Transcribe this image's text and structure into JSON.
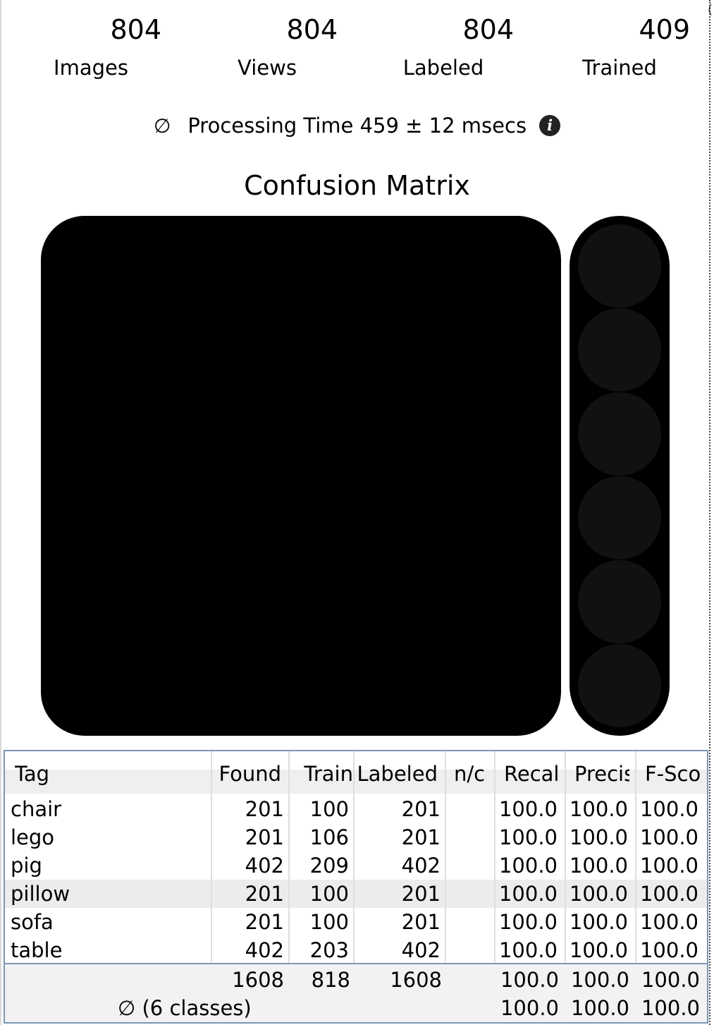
{
  "stats": [
    {
      "value": "804",
      "label": "Images"
    },
    {
      "value": "804",
      "label": "Views"
    },
    {
      "value": "804",
      "label": "Labeled"
    },
    {
      "value": "409",
      "label": "Trained"
    }
  ],
  "processing": {
    "avg_symbol": "∅",
    "text": "Processing Time 459 ± 12 msecs",
    "info_glyph": "i"
  },
  "confusion_matrix": {
    "title": "Confusion Matrix"
  },
  "table": {
    "columns": [
      "Tag",
      "Found",
      "Train",
      "Labeled",
      "n/c",
      "Recall",
      "Precis",
      "F-Sco"
    ],
    "rows": [
      {
        "tag": "chair",
        "found": "201",
        "train": "100",
        "labeled": "201",
        "nc": "",
        "recall": "100.0",
        "precision": "100.0",
        "fscore": "100.0"
      },
      {
        "tag": "lego",
        "found": "201",
        "train": "106",
        "labeled": "201",
        "nc": "",
        "recall": "100.0",
        "precision": "100.0",
        "fscore": "100.0"
      },
      {
        "tag": "pig",
        "found": "402",
        "train": "209",
        "labeled": "402",
        "nc": "",
        "recall": "100.0",
        "precision": "100.0",
        "fscore": "100.0"
      },
      {
        "tag": "pillow",
        "found": "201",
        "train": "100",
        "labeled": "201",
        "nc": "",
        "recall": "100.0",
        "precision": "100.0",
        "fscore": "100.0"
      },
      {
        "tag": "sofa",
        "found": "201",
        "train": "100",
        "labeled": "201",
        "nc": "",
        "recall": "100.0",
        "precision": "100.0",
        "fscore": "100.0"
      },
      {
        "tag": "table",
        "found": "402",
        "train": "203",
        "labeled": "402",
        "nc": "",
        "recall": "100.0",
        "precision": "100.0",
        "fscore": "100.0"
      }
    ],
    "selected_row": "pillow",
    "totals": {
      "found": "1608",
      "train": "818",
      "labeled": "1608",
      "recall": "100.0",
      "precision": "100.0",
      "fscore": "100.0"
    },
    "average": {
      "label": "∅ (6 classes)",
      "recall": "100.0",
      "precision": "100.0",
      "fscore": "100.0"
    }
  },
  "colors": {
    "table_border": "#7d95b3",
    "selected_row": "#ececec",
    "matrix": "#000000"
  }
}
